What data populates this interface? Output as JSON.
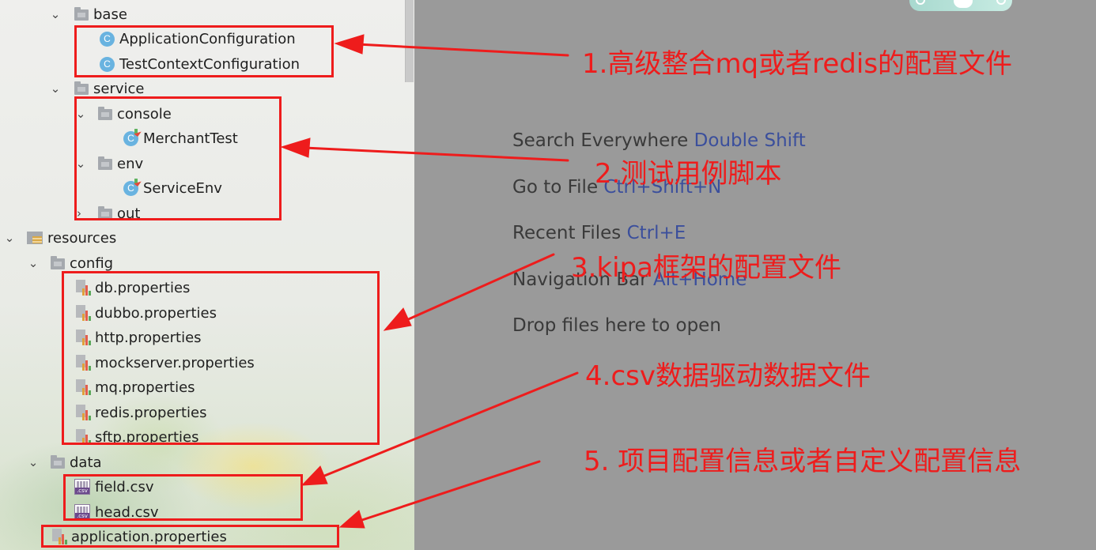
{
  "project_tree": {
    "base_folder": "base",
    "base_items": [
      "ApplicationConfiguration",
      "TestContextConfiguration"
    ],
    "service_folder": "service",
    "console_folder": "console",
    "console_items": [
      "MerchantTest"
    ],
    "env_folder": "env",
    "env_items": [
      "ServiceEnv"
    ],
    "out_folder": "out",
    "resources_folder": "resources",
    "config_folder": "config",
    "config_files": [
      "db.properties",
      "dubbo.properties",
      "http.properties",
      "mockserver.properties",
      "mq.properties",
      "redis.properties",
      "sftp.properties"
    ],
    "data_folder": "data",
    "data_files": [
      "field.csv",
      "head.csv"
    ],
    "root_file": "application.properties",
    "class_icon_letter": "C",
    "csv_icon_label": ".csv"
  },
  "editor_hints": {
    "search_label": "Search Everywhere",
    "search_key": "Double Shift",
    "goto_label": "Go to File",
    "goto_key": "Ctrl+Shift+N",
    "recent_label": "Recent Files",
    "recent_key": "Ctrl+E",
    "nav_label": "Navigation Bar",
    "nav_key": "Alt+Home",
    "drop_text": "Drop files here to open"
  },
  "annotations": {
    "a1": "1.高级整合mq或者redis的配置文件",
    "a2": "2.测试用例脚本",
    "a3": "3.kipa框架的配置文件",
    "a4": "4.csv数据驱动数据文件",
    "a5": "5. 项目配置信息或者自定义配置信息",
    "color": "#ee1c1c"
  },
  "colors": {
    "hint_key": "#3b4f9c",
    "editor_bg": "#9a9a9a",
    "class_icon": "#69b3e0"
  }
}
